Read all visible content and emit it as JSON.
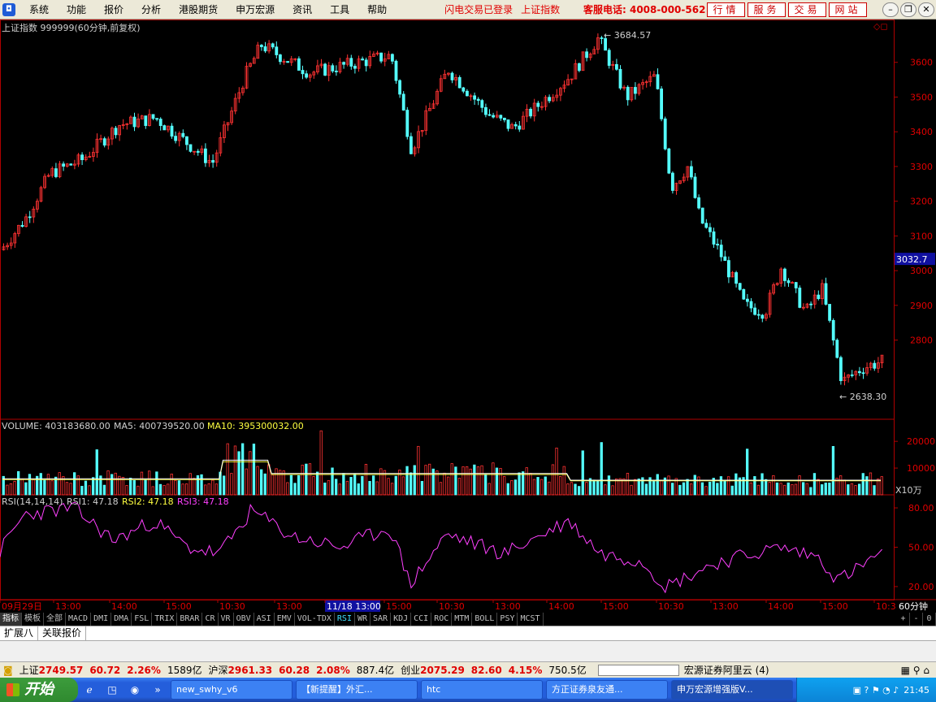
{
  "menubar": {
    "items": [
      "系统",
      "功能",
      "报价",
      "分析",
      "港股期货",
      "申万宏源",
      "资讯",
      "工具",
      "帮助"
    ],
    "status_login": "闪电交易已登录",
    "status_index": "上证指数",
    "hotline": "客服电话: 4008-000-562",
    "nav_buttons": [
      "行情",
      "服务",
      "交易",
      "网站"
    ]
  },
  "main_chart": {
    "title": "上证指数 999999(60分钟,前复权)",
    "price_high_label": "3684.57",
    "price_low_label": "2638.30",
    "current_price_tag": "3032.7",
    "y_ticks": [
      "3600",
      "3500",
      "3400",
      "3300",
      "3200",
      "3100",
      "3000",
      "2900",
      "2800"
    ],
    "colors": {
      "up": "#ff3232",
      "down": "#54ffff",
      "axis": "#b00000"
    }
  },
  "volume_panel": {
    "label_volume": "VOLUME: 403183680.00",
    "label_ma5": "MA5: 400739520.00",
    "label_ma10": "MA10: 395300032.00",
    "y_ticks": [
      "20000",
      "10000"
    ],
    "unit": "X10万"
  },
  "rsi_panel": {
    "label_main": "RSI(14,14,14)",
    "label_rsi1": "RSI1: 47.18",
    "label_rsi2": "RSI2: 47.18",
    "label_rsi3": "RSI3: 47.18",
    "y_ticks": [
      "80.00",
      "50.00",
      "20.00"
    ]
  },
  "time_axis": {
    "labels": [
      "09月29日",
      "13:00",
      "14:00",
      "15:00",
      "10:30",
      "13:00",
      "11/18 13:00",
      "15:00",
      "10:30",
      "13:00",
      "14:00",
      "15:00",
      "10:30",
      "13:00",
      "14:00",
      "15:00",
      "10:3"
    ],
    "period": "60分钟"
  },
  "indicator_tabs": [
    "指标",
    "模板",
    "全部",
    "MACD",
    "DMI",
    "DMA",
    "FSL",
    "TRIX",
    "BRAR",
    "CR",
    "VR",
    "OBV",
    "ASI",
    "EMV",
    "VOL-TDX",
    "RSI",
    "WR",
    "SAR",
    "KDJ",
    "CCI",
    "ROC",
    "MTM",
    "BOLL",
    "PSY",
    "MCST"
  ],
  "active_tab": "RSI",
  "zoom_controls": [
    "+",
    "-",
    "0"
  ],
  "expand_bar": [
    "扩展八",
    "关联报价"
  ],
  "statusbar": {
    "sh_name": "上证",
    "sh_value": "2749.57",
    "sh_change": "60.72",
    "sh_pct": "2.26%",
    "sh_amount": "1589亿",
    "hs_name": "沪深",
    "hs_value": "2961.33",
    "hs_change": "60.28",
    "hs_pct": "2.08%",
    "hs_amount": "887.4亿",
    "cy_name": "创业",
    "cy_value": "2075.29",
    "cy_change": "82.60",
    "cy_pct": "4.15%",
    "cy_amount": "750.5亿",
    "server": "宏源证券阿里云 (4)"
  },
  "taskbar": {
    "start_label": "开始",
    "tasks": [
      "new_swhy_v6",
      "【新提醒】外汇...",
      "htc",
      "方正证券泉友通...",
      "申万宏源增强版V..."
    ],
    "clock": "21:45"
  }
}
